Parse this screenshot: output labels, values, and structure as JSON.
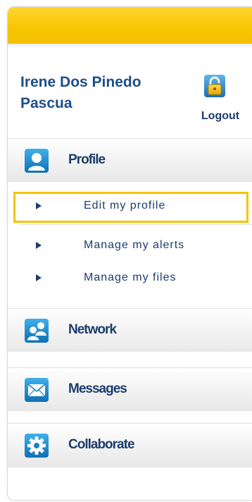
{
  "user": {
    "name_line1": "Irene Dos Pinedo",
    "name_line2": "Pascua"
  },
  "logout": {
    "label": "Logout",
    "icon": "logout-lock-icon"
  },
  "sections": {
    "profile": {
      "label": "Profile",
      "icon": "profile-person-icon"
    },
    "network": {
      "label": "Network",
      "icon": "network-people-icon"
    },
    "messages": {
      "label": "Messages",
      "icon": "envelope-icon"
    },
    "collaborate": {
      "label": "Collaborate",
      "icon": "gear-icon"
    }
  },
  "profile_items": [
    {
      "label": "Edit my profile",
      "active": true
    },
    {
      "label": "Manage my alerts",
      "active": false
    },
    {
      "label": "Manage my files",
      "active": false
    }
  ],
  "colors": {
    "accent_yellow": "#f5c400",
    "text_blue": "#1c3d6e",
    "name_blue": "#1c4e8c",
    "icon_blue": "#1a8fd0"
  }
}
